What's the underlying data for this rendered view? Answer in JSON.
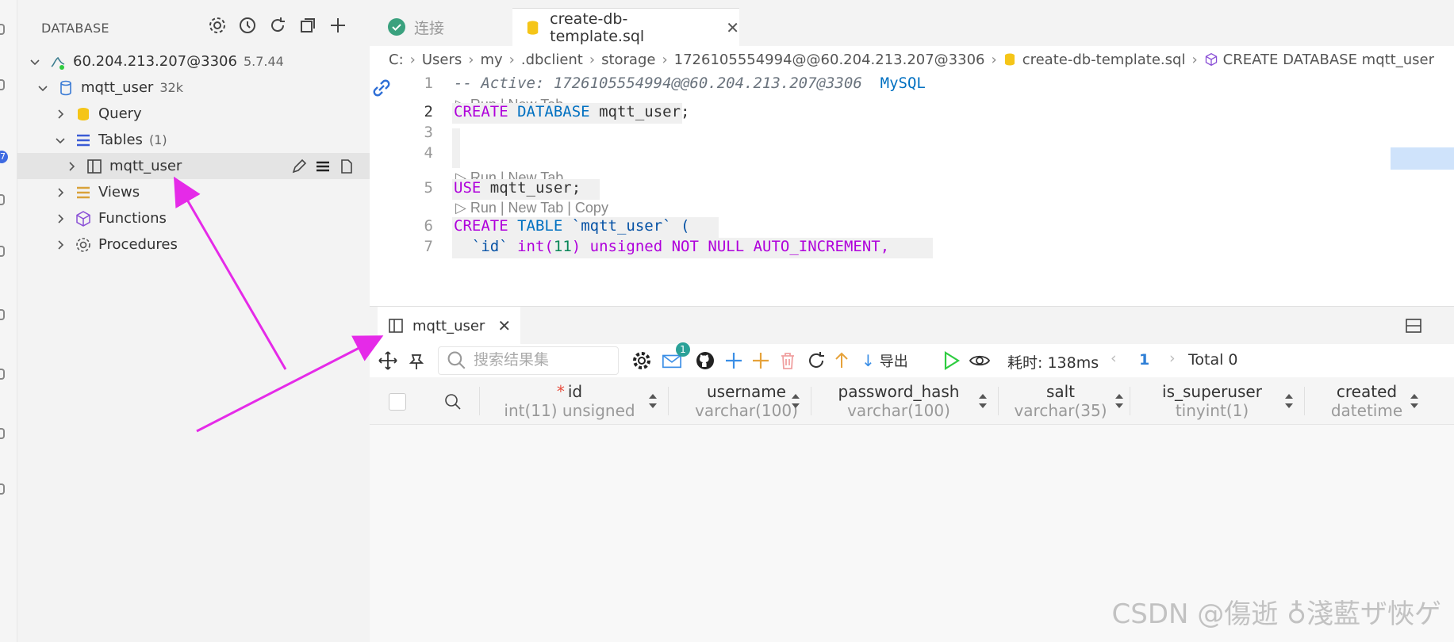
{
  "sidebar": {
    "title": "DATABASE",
    "connection": {
      "label": "60.204.213.207@3306",
      "version": "5.7.44"
    },
    "database": {
      "label": "mqtt_user",
      "size": "32k"
    },
    "items": [
      {
        "label": "Query"
      },
      {
        "label": "Tables",
        "count": "(1)"
      },
      {
        "label": "mqtt_user"
      },
      {
        "label": "Views"
      },
      {
        "label": "Functions"
      },
      {
        "label": "Procedures"
      }
    ]
  },
  "tabs": [
    {
      "label": "连接"
    },
    {
      "label": "create-db-template.sql"
    }
  ],
  "breadcrumb": [
    "C:",
    "Users",
    "my",
    ".dbclient",
    "storage",
    "1726105554994@@60.204.213.207@3306",
    "create-db-template.sql",
    "CREATE DATABASE mqtt_user"
  ],
  "editor": {
    "line_numbers": [
      "1",
      "2",
      "3",
      "4",
      "5",
      "6",
      "7"
    ],
    "comment": "-- Active: 1726105554994@@60.204.213.207@3306",
    "comment_db": "MySQL",
    "codelens_1": "Run | New Tab",
    "codelens_2": "Run | New Tab",
    "codelens_3": "Run | New Tab | Copy",
    "line2_kw1": "CREATE",
    "line2_kw2": "DATABASE",
    "line2_rest": "mqtt_user;",
    "line5_kw": "USE",
    "line5_rest": "mqtt_user;",
    "line6_kw1": "CREATE",
    "line6_kw2": "TABLE",
    "line6_name": "`mqtt_user`",
    "line6_paren": "(",
    "line7_col": "`id`",
    "line7_type": "int(",
    "line7_num": "11",
    "line7_close": ")",
    "line7_mods": "unsigned NOT NULL AUTO_INCREMENT,"
  },
  "results": {
    "tab_label": "mqtt_user",
    "search_placeholder": "搜索结果集",
    "mail_badge": "1",
    "export_label": "导出",
    "elapsed": "耗时: 138ms",
    "page": "1",
    "total": "Total 0",
    "columns": [
      {
        "name": "id",
        "type": "int(11) unsigned",
        "required": "*"
      },
      {
        "name": "username",
        "type": "varchar(100)"
      },
      {
        "name": "password_hash",
        "type": "varchar(100)"
      },
      {
        "name": "salt",
        "type": "varchar(35)"
      },
      {
        "name": "is_superuser",
        "type": "tinyint(1)"
      },
      {
        "name": "created",
        "type": "datetime"
      }
    ]
  },
  "watermark": "CSDN @傷逝 ♁淺藍ザ悏ゲ",
  "colors": {
    "accent": "#e52ae8",
    "keyword": "#af00db",
    "type": "#0070c1"
  }
}
